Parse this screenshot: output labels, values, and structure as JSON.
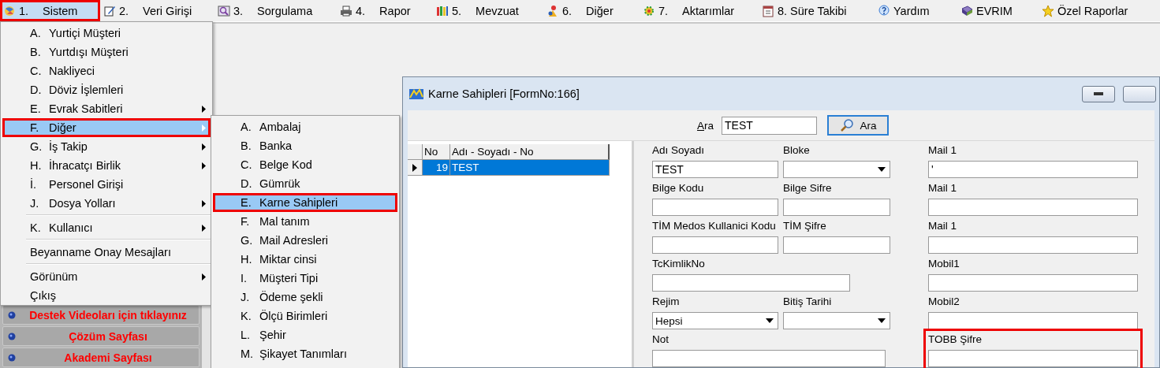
{
  "menubar": [
    {
      "number": "1.",
      "label": "Sistem",
      "selected": true,
      "highlighted": true
    },
    {
      "number": "2.",
      "label": "Veri Girişi",
      "selected": false,
      "highlighted": false
    },
    {
      "number": "3.",
      "label": "Sorgulama",
      "selected": false,
      "highlighted": false
    },
    {
      "number": "4.",
      "label": "Rapor",
      "selected": false,
      "highlighted": false
    },
    {
      "number": "5.",
      "label": "Mevzuat",
      "selected": false,
      "highlighted": false
    },
    {
      "number": "6.",
      "label": "Diğer",
      "selected": false,
      "highlighted": false
    },
    {
      "number": "7.",
      "label": "Aktarımlar",
      "selected": false,
      "highlighted": false
    },
    {
      "label": "8. Süre Takibi",
      "selected": false,
      "highlighted": false
    },
    {
      "label": "Yardım",
      "selected": false,
      "highlighted": false
    },
    {
      "label": "EVRIM",
      "selected": false,
      "highlighted": false
    },
    {
      "label": "Özel Raporlar",
      "selected": false,
      "highlighted": false
    }
  ],
  "sidebar": {
    "buttons": [
      {
        "label": "Destek Videoları için tıklayınız"
      },
      {
        "label": "Çözüm Sayfası"
      },
      {
        "label": "Akademi Sayfası"
      }
    ]
  },
  "menu": {
    "items": [
      {
        "kind": "item",
        "key": "A.",
        "label": "Yurtiçi Müşteri",
        "submenu": false,
        "selected": false,
        "highlighted": false
      },
      {
        "kind": "item",
        "key": "B.",
        "label": "Yurtdışı Müşteri",
        "submenu": false,
        "selected": false,
        "highlighted": false
      },
      {
        "kind": "item",
        "key": "C.",
        "label": "Nakliyeci",
        "submenu": false,
        "selected": false,
        "highlighted": false
      },
      {
        "kind": "item",
        "key": "D.",
        "label": "Döviz İşlemleri",
        "submenu": false,
        "selected": false,
        "highlighted": false
      },
      {
        "kind": "item",
        "key": "E.",
        "label": "Evrak Sabitleri",
        "submenu": true,
        "selected": false,
        "highlighted": false
      },
      {
        "kind": "item",
        "key": "F.",
        "label": "Diğer",
        "submenu": true,
        "selected": true,
        "highlighted": true
      },
      {
        "kind": "item",
        "key": "G.",
        "label": "İş Takip",
        "submenu": true,
        "selected": false,
        "highlighted": false
      },
      {
        "kind": "item",
        "key": "H.",
        "label": "İhracatçı Birlik",
        "submenu": true,
        "selected": false,
        "highlighted": false
      },
      {
        "kind": "item",
        "key": "İ.",
        "label": "Personel Girişi",
        "submenu": false,
        "selected": false,
        "highlighted": false
      },
      {
        "kind": "item",
        "key": "J.",
        "label": "Dosya Yolları",
        "submenu": true,
        "selected": false,
        "highlighted": false
      },
      {
        "kind": "separator"
      },
      {
        "kind": "item",
        "key": "K.",
        "label": "Kullanıcı",
        "submenu": true,
        "selected": false,
        "highlighted": false
      },
      {
        "kind": "separator"
      },
      {
        "kind": "item",
        "label": "Beyanname Onay Mesajları",
        "submenu": false,
        "selected": false,
        "highlighted": false
      },
      {
        "kind": "separator"
      },
      {
        "kind": "item",
        "label": "Görünüm",
        "submenu": true,
        "selected": false,
        "highlighted": false
      },
      {
        "kind": "item",
        "label": "Çıkış",
        "submenu": false,
        "selected": false,
        "highlighted": false
      }
    ]
  },
  "submenu": {
    "items": [
      {
        "kind": "item",
        "key": "A.",
        "label": "Ambalaj",
        "submenu": false,
        "selected": false,
        "highlighted": false
      },
      {
        "kind": "item",
        "key": "B.",
        "label": "Banka",
        "submenu": false,
        "selected": false,
        "highlighted": false
      },
      {
        "kind": "item",
        "key": "C.",
        "label": "Belge Kod",
        "submenu": false,
        "selected": false,
        "highlighted": false
      },
      {
        "kind": "item",
        "key": "D.",
        "label": "Gümrük",
        "submenu": false,
        "selected": false,
        "highlighted": false
      },
      {
        "kind": "item",
        "key": "E.",
        "label": "Karne Sahipleri",
        "submenu": false,
        "selected": true,
        "highlighted": true
      },
      {
        "kind": "item",
        "key": "F.",
        "label": "Mal tanım",
        "submenu": false,
        "selected": false,
        "highlighted": false
      },
      {
        "kind": "item",
        "key": "G.",
        "label": "Mail Adresleri",
        "submenu": false,
        "selected": false,
        "highlighted": false
      },
      {
        "kind": "item",
        "key": "H.",
        "label": "Miktar cinsi",
        "submenu": false,
        "selected": false,
        "highlighted": false
      },
      {
        "kind": "item",
        "key": "I.",
        "label": "Müşteri Tipi",
        "submenu": false,
        "selected": false,
        "highlighted": false
      },
      {
        "kind": "item",
        "key": "J.",
        "label": "Ödeme şekli",
        "submenu": false,
        "selected": false,
        "highlighted": false
      },
      {
        "kind": "item",
        "key": "K.",
        "label": "Ölçü Birimleri",
        "submenu": false,
        "selected": false,
        "highlighted": false
      },
      {
        "kind": "item",
        "key": "L.",
        "label": "Şehir",
        "submenu": false,
        "selected": false,
        "highlighted": false
      },
      {
        "kind": "item",
        "key": "M.",
        "label": "Şikayet Tanımları",
        "submenu": false,
        "selected": false,
        "highlighted": false
      }
    ]
  },
  "window": {
    "title": "Karne Sahipleri [FormNo:166]"
  },
  "search": {
    "label": "Ara",
    "value": "TEST",
    "button": "Ara"
  },
  "grid": {
    "columns": [
      "No",
      "Adı - Soyadı - No"
    ],
    "rows": [
      {
        "cells": [
          "19",
          "TEST"
        ],
        "selected": true
      }
    ]
  },
  "form": {
    "rows": [
      {
        "left": [
          {
            "label": "Adı Soyadı",
            "kind": "text",
            "value": "TEST"
          },
          {
            "label": "Bloke",
            "kind": "combo"
          }
        ],
        "right": {
          "label": "Mail 1",
          "kind": "text",
          "value": "'",
          "highlighted": false
        }
      },
      {
        "left": [
          {
            "label": "Bilge Kodu",
            "kind": "text"
          },
          {
            "label": "Bilge Sifre",
            "kind": "text"
          }
        ],
        "right": {
          "label": "Mail 1",
          "kind": "text",
          "highlighted": false
        }
      },
      {
        "left": [
          {
            "label": "TİM Medos Kullanici Kodu",
            "kind": "text"
          },
          {
            "label": "TİM Şifre",
            "kind": "text"
          }
        ],
        "right": {
          "label": "Mail 1",
          "kind": "text",
          "highlighted": false
        }
      },
      {
        "left": [
          {
            "label": "TcKimlikNo",
            "kind": "text"
          }
        ],
        "right": {
          "label": "Mobil1",
          "kind": "text",
          "highlighted": false
        }
      },
      {
        "left": [
          {
            "label": "Rejim",
            "kind": "combo",
            "value": "Hepsi"
          },
          {
            "label": "Bitiş Tarihi",
            "kind": "combo"
          }
        ],
        "right": {
          "label": "Mobil2",
          "kind": "text",
          "highlighted": false
        }
      },
      {
        "left": [
          {
            "label": "Not",
            "kind": "text"
          }
        ],
        "right": {
          "label": "TOBB Şifre",
          "kind": "text",
          "highlighted": true
        }
      }
    ]
  }
}
